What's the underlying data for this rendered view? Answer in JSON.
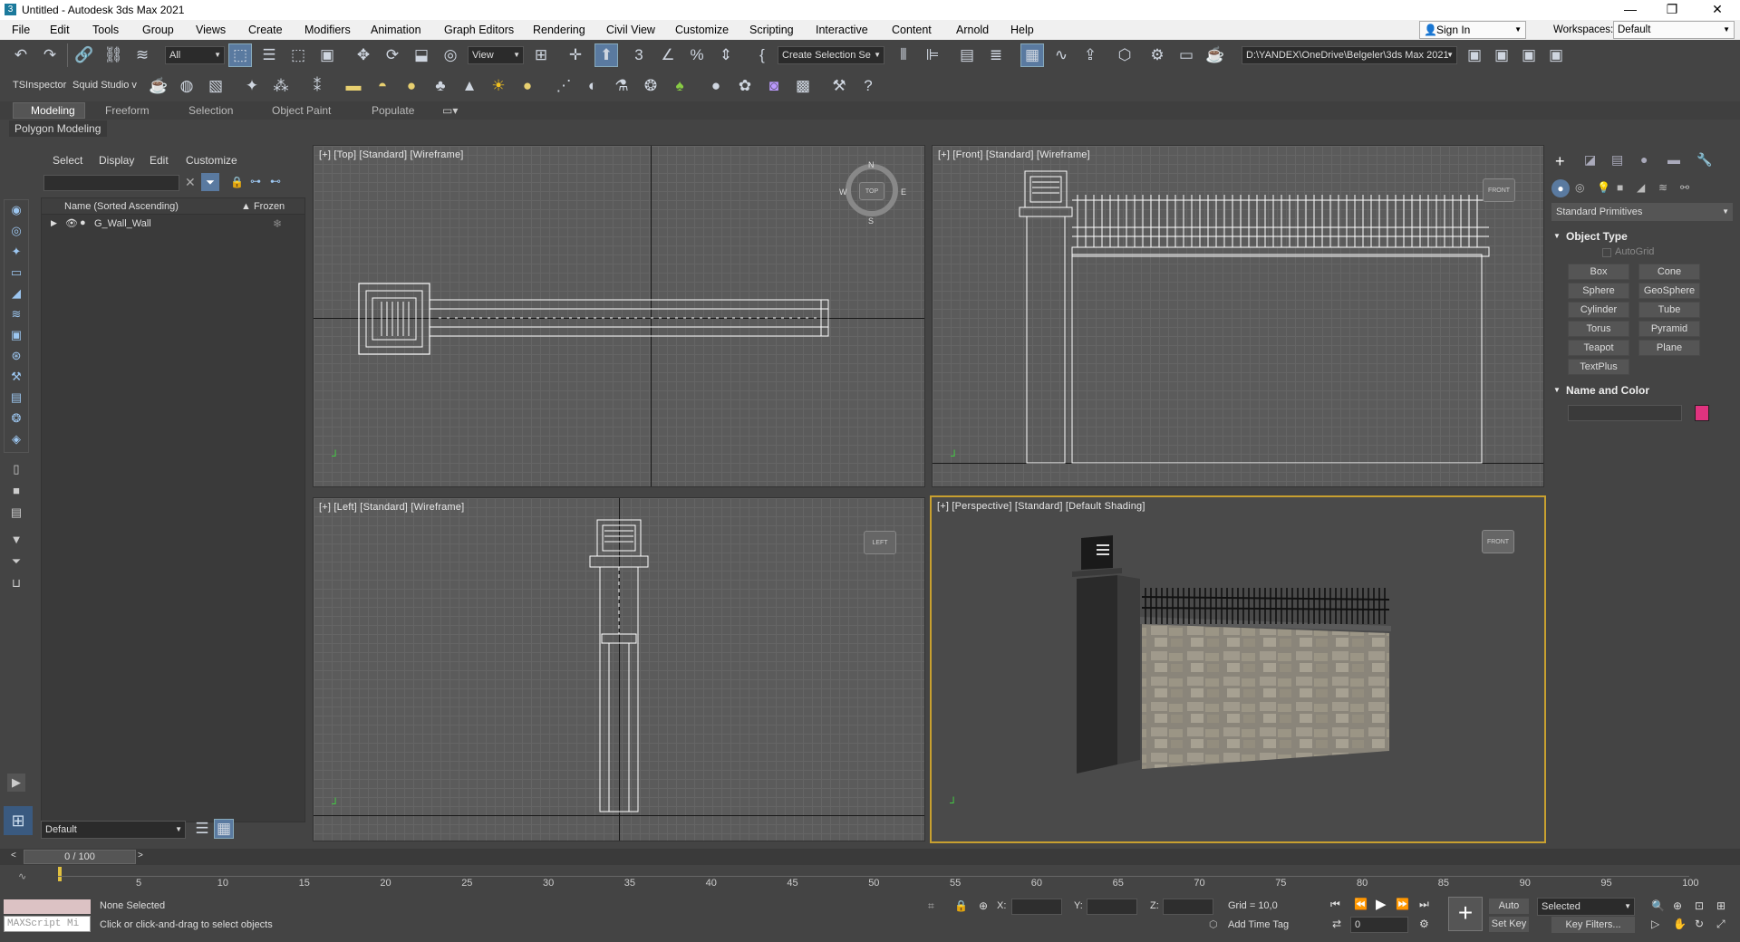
{
  "window": {
    "title": "Untitled - Autodesk 3ds Max 2021",
    "minimize": "—",
    "restore": "❐",
    "close": "✕"
  },
  "menu": {
    "items": [
      "File",
      "Edit",
      "Tools",
      "Group",
      "Views",
      "Create",
      "Modifiers",
      "Animation",
      "Graph Editors",
      "Rendering",
      "Civil View",
      "Customize",
      "Scripting",
      "Interactive",
      "Content",
      "Arnold",
      "Help"
    ],
    "sign_in": "Sign In",
    "workspaces_label": "Workspaces:",
    "workspace": "Default"
  },
  "toolbar": {
    "selection_filter": "All",
    "reference_coord": "View",
    "named_selection": "Create Selection Se",
    "project_path": "D:\\YANDEX\\OneDrive\\Belgeler\\3ds Max 2021",
    "ts_inspector": "TSInspector",
    "squid_studio": "Squid Studio v"
  },
  "ribbon": {
    "tabs": [
      "Modeling",
      "Freeform",
      "Selection",
      "Object Paint",
      "Populate"
    ],
    "active": "Modeling",
    "subtitle": "Polygon Modeling"
  },
  "scene_explorer": {
    "tabs": [
      "Select",
      "Display",
      "Edit",
      "Customize"
    ],
    "col_name": "Name (Sorted Ascending)",
    "col_frozen": "▲ Frozen",
    "items": [
      {
        "name": "G_Wall_Wall"
      }
    ],
    "layer": "Default"
  },
  "viewports": {
    "top": {
      "label": "[+] [Top] [Standard] [Wireframe]",
      "compass": [
        "N",
        "S",
        "E",
        "W"
      ],
      "cube": "TOP"
    },
    "front": {
      "label": "[+] [Front] [Standard] [Wireframe]",
      "cube": "FRONT"
    },
    "left": {
      "label": "[+] [Left] [Standard] [Wireframe]",
      "cube": "LEFT"
    },
    "perspective": {
      "label": "[+] [Perspective] [Standard] [Default Shading]",
      "cube": "FRONT"
    }
  },
  "command_panel": {
    "category": "Standard Primitives",
    "object_type_header": "Object Type",
    "autogrid": "AutoGrid",
    "buttons": [
      "Box",
      "Cone",
      "Sphere",
      "GeoSphere",
      "Cylinder",
      "Tube",
      "Torus",
      "Pyramid",
      "Teapot",
      "Plane",
      "TextPlus"
    ],
    "name_color_header": "Name and Color",
    "color": "#e0337f"
  },
  "timeline": {
    "frame": "0 / 100",
    "ticks": [
      "5",
      "10",
      "15",
      "20",
      "25",
      "30",
      "35",
      "40",
      "45",
      "50",
      "55",
      "60",
      "65",
      "70",
      "75",
      "80",
      "85",
      "90",
      "95",
      "100"
    ]
  },
  "status": {
    "maxscript": "MAXScript Mi",
    "selection": "None Selected",
    "prompt": "Click or click-and-drag to select objects",
    "x_label": "X:",
    "y_label": "Y:",
    "z_label": "Z:",
    "grid": "Grid = 10,0",
    "add_time_tag": "Add Time Tag",
    "auto_key": "Auto Key",
    "set_key": "Set Key",
    "selected": "Selected",
    "key_filters": "Key Filters...",
    "frame_field": "0"
  }
}
